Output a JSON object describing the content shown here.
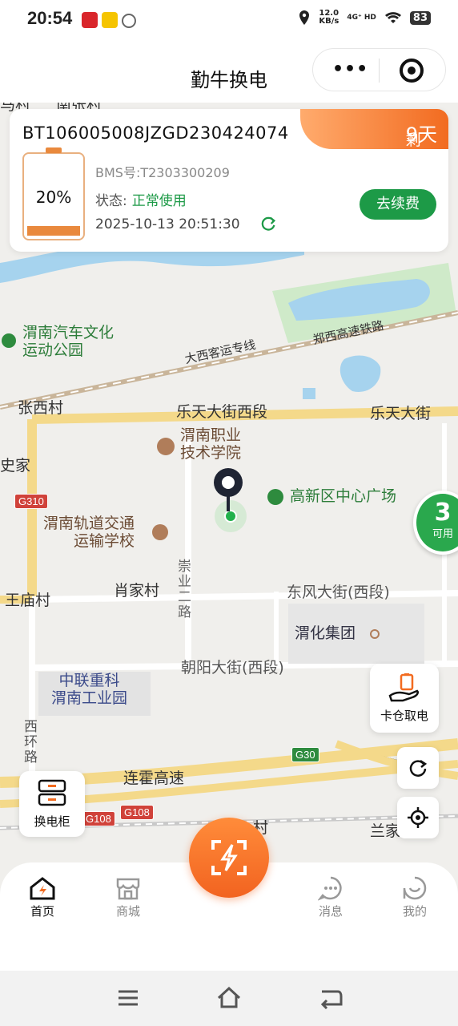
{
  "status_bar": {
    "time": "20:54",
    "net_speed": "12.0\nKB/s",
    "net_label": "4G⁺ HD",
    "battery": "83"
  },
  "header": {
    "title": "勤牛换电",
    "menu_label": "•••"
  },
  "device_card": {
    "serial": "BT106005008JZGD230424074",
    "remaining_prefix": "剩余: ",
    "remaining_value": "9天",
    "battery_percent": "20%",
    "battery_level": 0.2,
    "bms": "BMS号:T2303300209",
    "status_label": "状态:",
    "status_value": "正常使用",
    "timestamp": "2025-10-13 20:51:30",
    "renew_label": "去续费",
    "accent": "#1d9a47"
  },
  "map": {
    "labels": {
      "park": "渭南汽车文化\n运动公园",
      "rail1": "大西客运专线",
      "rail2": "郑西高速铁路",
      "zhangxi": "张西村",
      "letian_west": "乐天大街西段",
      "letian": "乐天大街",
      "college": "渭南职业\n技术学院",
      "jia": "史家",
      "plaza": "高新区中心广场",
      "transport_school": "渭南轨道交通\n运输学校",
      "chongye": "崇\n业\n二\n路",
      "wangmiao": "王庙村",
      "xiaojia": "肖家村",
      "dongfeng": "东风大街(西段)",
      "weihua": "渭化集团",
      "chaoyang": "朝阳大街(西段)",
      "zhonglian": "中联重科\n渭南工业园",
      "xihuan": "西\n环\n路",
      "lianhuo": "连霍高速",
      "lanjia": "兰家",
      "cun": "村",
      "top1": "马村",
      "top2": "南张村"
    },
    "shields": {
      "g310": "G310",
      "g30": "G30",
      "g108a": "G108",
      "g108b": "G108"
    },
    "badge": {
      "count": "3",
      "label": "可用"
    },
    "buttons": {
      "card_take": "卡仓取电",
      "swap_cabinet": "换电柜"
    }
  },
  "nav": {
    "home": "首页",
    "mall": "商城",
    "messages": "消息",
    "mine": "我的"
  }
}
